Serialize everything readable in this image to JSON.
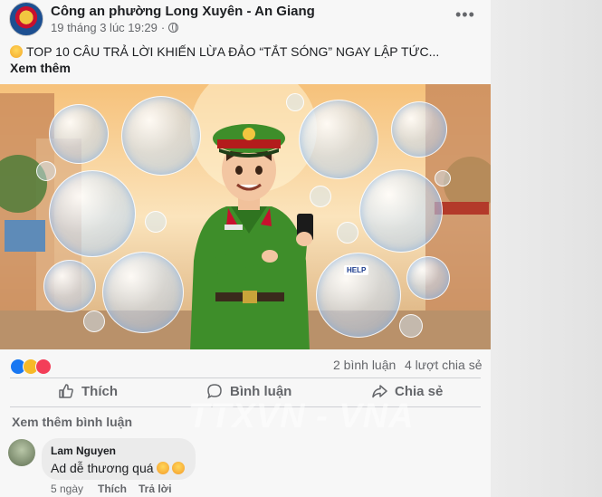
{
  "post": {
    "page_name": "Công an phường Long Xuyên - An Giang",
    "timestamp": "19 tháng 3 lúc 19:29",
    "dot_separator": "·",
    "more_icon": "•••",
    "caption": "TOP 10 CÂU TRẢ LỜI KHIẾN LỪA ĐẢO “TẮT SÓNG” NGAY LẬP TỨC...",
    "see_more": "Xem thêm"
  },
  "stats": {
    "comments": "2 bình luận",
    "shares": "4 lượt chia sẻ",
    "reactions": [
      "like",
      "haha",
      "love"
    ]
  },
  "actions": {
    "like": "Thích",
    "comment": "Bình luận",
    "share": "Chia sẻ"
  },
  "comments_section": {
    "view_more": "Xem thêm bình luận",
    "comment": {
      "author": "Lam Nguyen",
      "text": "Ad dễ thương quá",
      "age": "5 ngày",
      "like_label": "Thích",
      "reply_label": "Trả lời"
    }
  },
  "image": {
    "badge_help": "HELP"
  },
  "watermark": "TTXVN - VNA",
  "colors": {
    "uniform_green": "#3e8e2a",
    "accent_blue": "#1877f2",
    "muted_text": "#65676b"
  }
}
